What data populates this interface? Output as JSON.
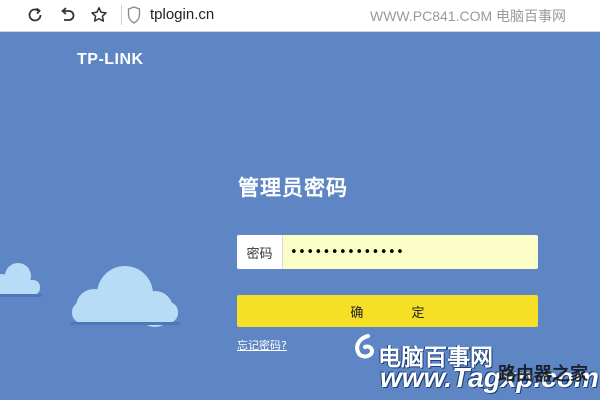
{
  "browser": {
    "url": "tplogin.cn",
    "watermark": "WWW.PC841.COM 电脑百事网",
    "buttons": [
      "refresh-icon",
      "back-icon",
      "bookmark-star-icon"
    ]
  },
  "page": {
    "brand": "TP-LINK",
    "title": "管理员密码",
    "password_label": "密码",
    "password_value": "••••••••••••••",
    "confirm_label": "确 定",
    "forgot_label": "忘记密码?"
  },
  "watermark_bottom": {
    "cn": "电脑百事网",
    "domain": "www.Tagxp.com",
    "overlay": "路由器之家"
  },
  "colors": {
    "background": "#5f86c4",
    "input_bg": "#fcfec7",
    "button": "#f6e026",
    "cloud": "#b9dcf6"
  }
}
